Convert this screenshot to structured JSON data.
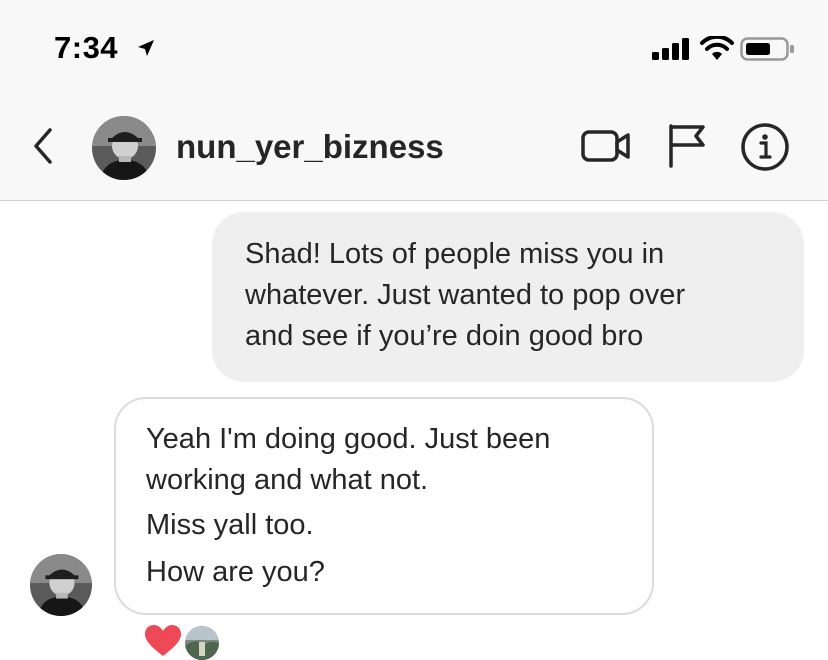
{
  "status_bar": {
    "time": "7:34",
    "icons": [
      "location-arrow-icon",
      "signal-icon",
      "wifi-icon",
      "battery-icon"
    ]
  },
  "header": {
    "back_icon": "chevron-left-icon",
    "username": "nun_yer_bizness",
    "actions": [
      "video-camera-icon",
      "flag-icon",
      "info-icon"
    ]
  },
  "messages": [
    {
      "direction": "outgoing",
      "lines": [
        "Shad! Lots of people miss you in",
        "whatever. Just wanted to pop over",
        "and see if you’re doin good bro"
      ]
    },
    {
      "direction": "incoming",
      "lines": [
        "Yeah I'm doing good. Just been",
        "working and what not.",
        "Miss yall too.",
        "How are you?"
      ],
      "reactions": [
        "heart-icon",
        "reactor-avatar"
      ]
    }
  ],
  "colors": {
    "header_bg": "#f8f8f8",
    "outgoing_bubble": "#efefef",
    "incoming_border": "#dbdbdb",
    "heart": "#ed4956"
  }
}
